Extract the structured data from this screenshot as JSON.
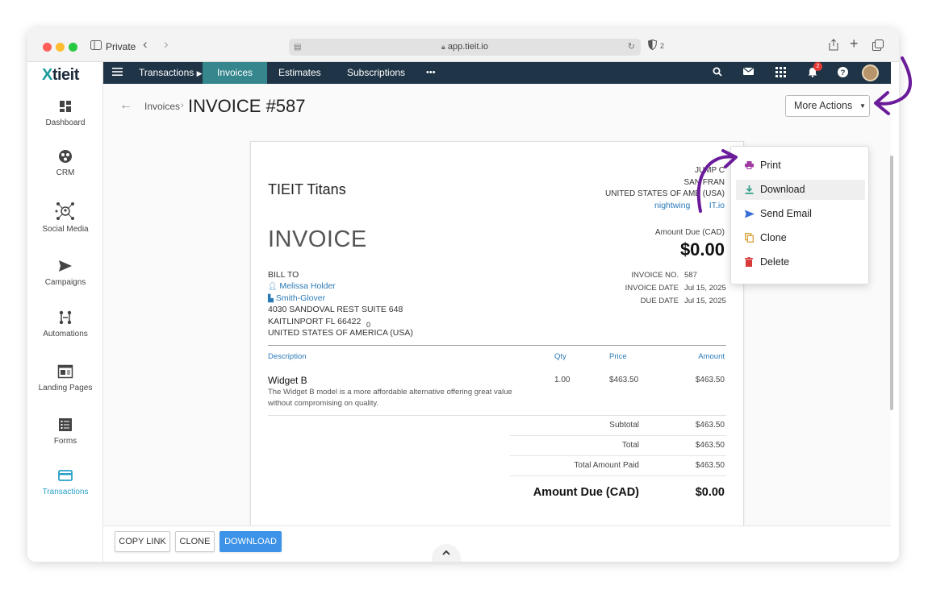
{
  "browser": {
    "private_label": "Private",
    "url": "app.tieit.io",
    "shield_count": "2"
  },
  "brand": {
    "logo_text": "tieit",
    "logo_mark": "X"
  },
  "sidebar": {
    "items": [
      {
        "label": "Dashboard",
        "icon": "dashboard-icon"
      },
      {
        "label": "CRM",
        "icon": "crm-icon"
      },
      {
        "label": "Social Media",
        "icon": "social-media-icon"
      },
      {
        "label": "Campaigns",
        "icon": "send-icon"
      },
      {
        "label": "Automations",
        "icon": "automations-icon"
      },
      {
        "label": "Landing Pages",
        "icon": "landing-page-icon"
      },
      {
        "label": "Forms",
        "icon": "forms-icon"
      },
      {
        "label": "Transactions",
        "icon": "card-icon"
      }
    ],
    "active": "Transactions"
  },
  "topnav": {
    "transactions": "Transactions",
    "invoices": "Invoices",
    "estimates": "Estimates",
    "subscriptions": "Subscriptions",
    "more": "•••",
    "notification_count": "2"
  },
  "header": {
    "breadcrumb": "Invoices",
    "title": "INVOICE #587",
    "more_actions": "More Actions"
  },
  "invoice": {
    "company": "TIEIT Titans",
    "heading": "INVOICE",
    "address": {
      "line1": "JUMP C",
      "line2": "SAN FRAN",
      "line3": "UNITED STATES OF AME",
      "line3_tail": "(USA)",
      "email": "nightwing",
      "email_tail": "IT.io"
    },
    "amount_due_label": "Amount Due (CAD)",
    "amount_due_value": "$0.00",
    "bill_to": {
      "label": "BILL TO",
      "contact": "Melissa Holder",
      "company": "Smith-Glover",
      "street": "4030 SANDOVAL REST SUITE 648",
      "city": "KAITLINPORT FL 66422",
      "country": "UNITED STATES OF AMERICA (USA)",
      "stray": "0"
    },
    "meta": {
      "number_label": "INVOICE NO.",
      "number": "587",
      "date_label": "INVOICE DATE",
      "date": "Jul 15, 2025",
      "due_label": "DUE DATE",
      "due": "Jul 15, 2025"
    },
    "columns": {
      "description": "Description",
      "qty": "Qty",
      "price": "Price",
      "amount": "Amount"
    },
    "items": [
      {
        "name": "Widget B",
        "description": "The Widget B model is a more affordable alternative offering great value without compromising on quality.",
        "qty": "1.00",
        "price": "$463.50",
        "amount": "$463.50"
      }
    ],
    "totals": {
      "subtotal_label": "Subtotal",
      "subtotal": "$463.50",
      "total_label": "Total",
      "total": "$463.50",
      "paid_label": "Total Amount Paid",
      "paid": "$463.50",
      "due_label": "Amount Due (CAD)",
      "due": "$0.00"
    }
  },
  "dropdown": {
    "items": [
      {
        "label": "Print",
        "icon": "print-icon",
        "color": "#a03aa0"
      },
      {
        "label": "Download",
        "icon": "download-icon",
        "color": "#3aa08c"
      },
      {
        "label": "Send Email",
        "icon": "send-email-icon",
        "color": "#3a6fd8"
      },
      {
        "label": "Clone",
        "icon": "clone-icon",
        "color": "#d8a23a"
      },
      {
        "label": "Delete",
        "icon": "trash-icon",
        "color": "#d83a3a"
      }
    ]
  },
  "bottombar": {
    "copy_link": "COPY LINK",
    "clone": "CLONE",
    "download": "DOWNLOAD"
  },
  "colors": {
    "nav_bg": "#1f3446",
    "nav_active": "#35868d",
    "primary_button": "#3d93e8",
    "link": "#2a7ab8",
    "annotation_arrow": "#6a1b9a"
  }
}
